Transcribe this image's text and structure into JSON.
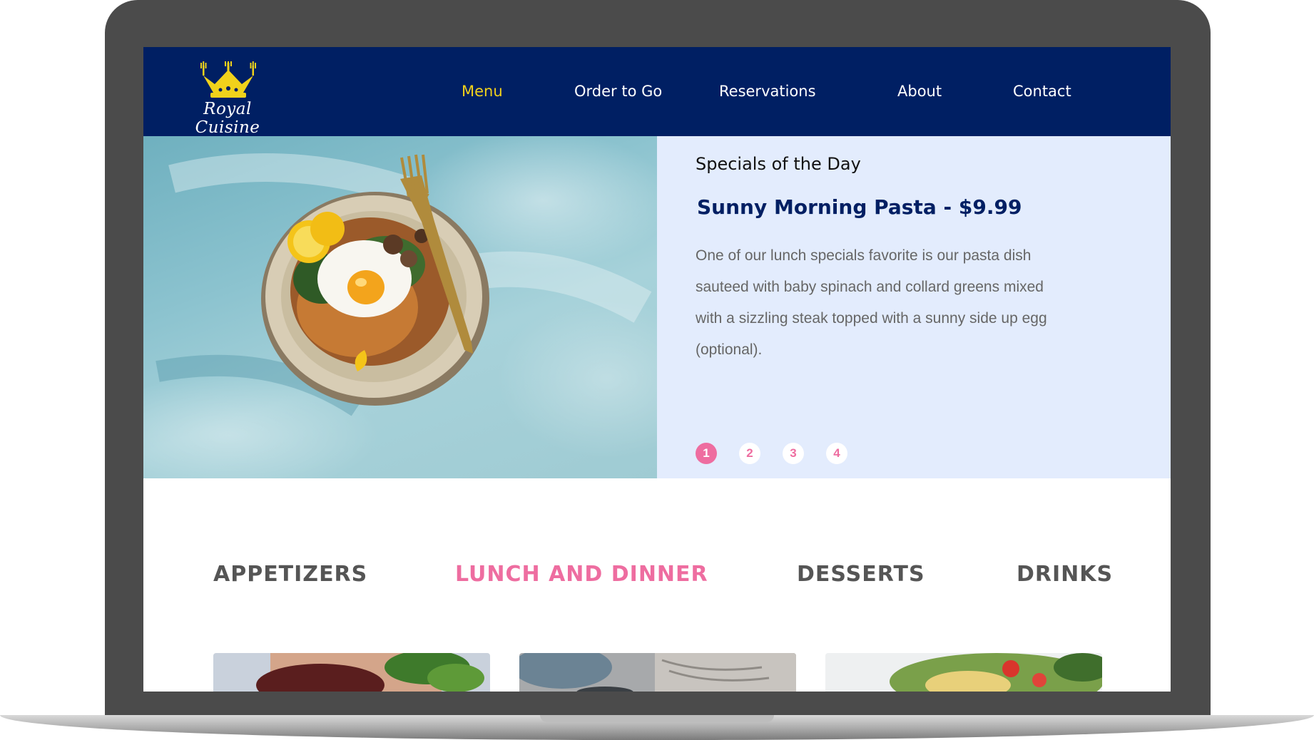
{
  "brand": {
    "name": "Royal Cuisine",
    "crown_color": "#f1d21b"
  },
  "nav": {
    "background": "#001f63",
    "items": [
      {
        "label": "Menu",
        "active": true
      },
      {
        "label": "Order to Go",
        "active": false
      },
      {
        "label": "Reservations",
        "active": false
      },
      {
        "label": "About",
        "active": false
      },
      {
        "label": "Contact",
        "active": false
      }
    ],
    "active_color": "#f1d21b"
  },
  "specials": {
    "heading": "Specials of the Day",
    "dish_title": "Sunny Morning Pasta - $9.99",
    "description": "One of our lunch specials favorite is our pasta dish sauteed with baby spinach and collard greens mixed with a sizzling steak topped with a sunny side up egg (optional).",
    "pages": [
      "1",
      "2",
      "3",
      "4"
    ],
    "active_page": "1",
    "panel_color": "#e3ecfd",
    "accent_color": "#ee6da0"
  },
  "menu_tabs": {
    "items": [
      {
        "label": "APPETIZERS",
        "active": false
      },
      {
        "label": "LUNCH AND DINNER",
        "active": true
      },
      {
        "label": "DESSERTS",
        "active": false
      },
      {
        "label": "DRINKS",
        "active": false
      }
    ]
  }
}
